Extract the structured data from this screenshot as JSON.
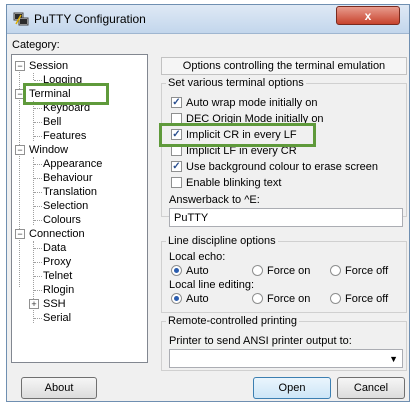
{
  "window": {
    "title": "PuTTY Configuration",
    "close_glyph": "x"
  },
  "category": {
    "label": "Category:",
    "tree": [
      {
        "label": "Session"
      },
      {
        "label": "Logging"
      },
      {
        "label": "Terminal"
      },
      {
        "label": "Keyboard"
      },
      {
        "label": "Bell"
      },
      {
        "label": "Features"
      },
      {
        "label": "Window"
      },
      {
        "label": "Appearance"
      },
      {
        "label": "Behaviour"
      },
      {
        "label": "Translation"
      },
      {
        "label": "Selection"
      },
      {
        "label": "Colours"
      },
      {
        "label": "Connection"
      },
      {
        "label": "Data"
      },
      {
        "label": "Proxy"
      },
      {
        "label": "Telnet"
      },
      {
        "label": "Rlogin"
      },
      {
        "label": "SSH"
      },
      {
        "label": "Serial"
      }
    ],
    "expander_minus": "−",
    "expander_plus": "+"
  },
  "panel": {
    "title": "Options controlling the terminal emulation",
    "options_group": "Set various terminal options",
    "checkboxes": [
      {
        "label": "Auto wrap mode initially on",
        "checked": true
      },
      {
        "label": "DEC Origin Mode initially on",
        "checked": false
      },
      {
        "label": "Implicit CR in every LF",
        "checked": true
      },
      {
        "label": "Implicit LF in every CR",
        "checked": false
      },
      {
        "label": "Use background colour to erase screen",
        "checked": true
      },
      {
        "label": "Enable blinking text",
        "checked": false
      }
    ],
    "answerback_label": "Answerback to ^E:",
    "answerback_value": "PuTTY",
    "line_group": "Line discipline options",
    "local_echo_label": "Local echo:",
    "local_edit_label": "Local line editing:",
    "radio_options": [
      "Auto",
      "Force on",
      "Force off"
    ],
    "echo_selected": "Auto",
    "edit_selected": "Auto",
    "printing_group": "Remote-controlled printing",
    "printer_label": "Printer to send ANSI printer output to:",
    "printer_value": ""
  },
  "buttons": {
    "about": "About",
    "open": "Open",
    "cancel": "Cancel"
  },
  "colors": {
    "highlight": "#5f9a3b"
  }
}
